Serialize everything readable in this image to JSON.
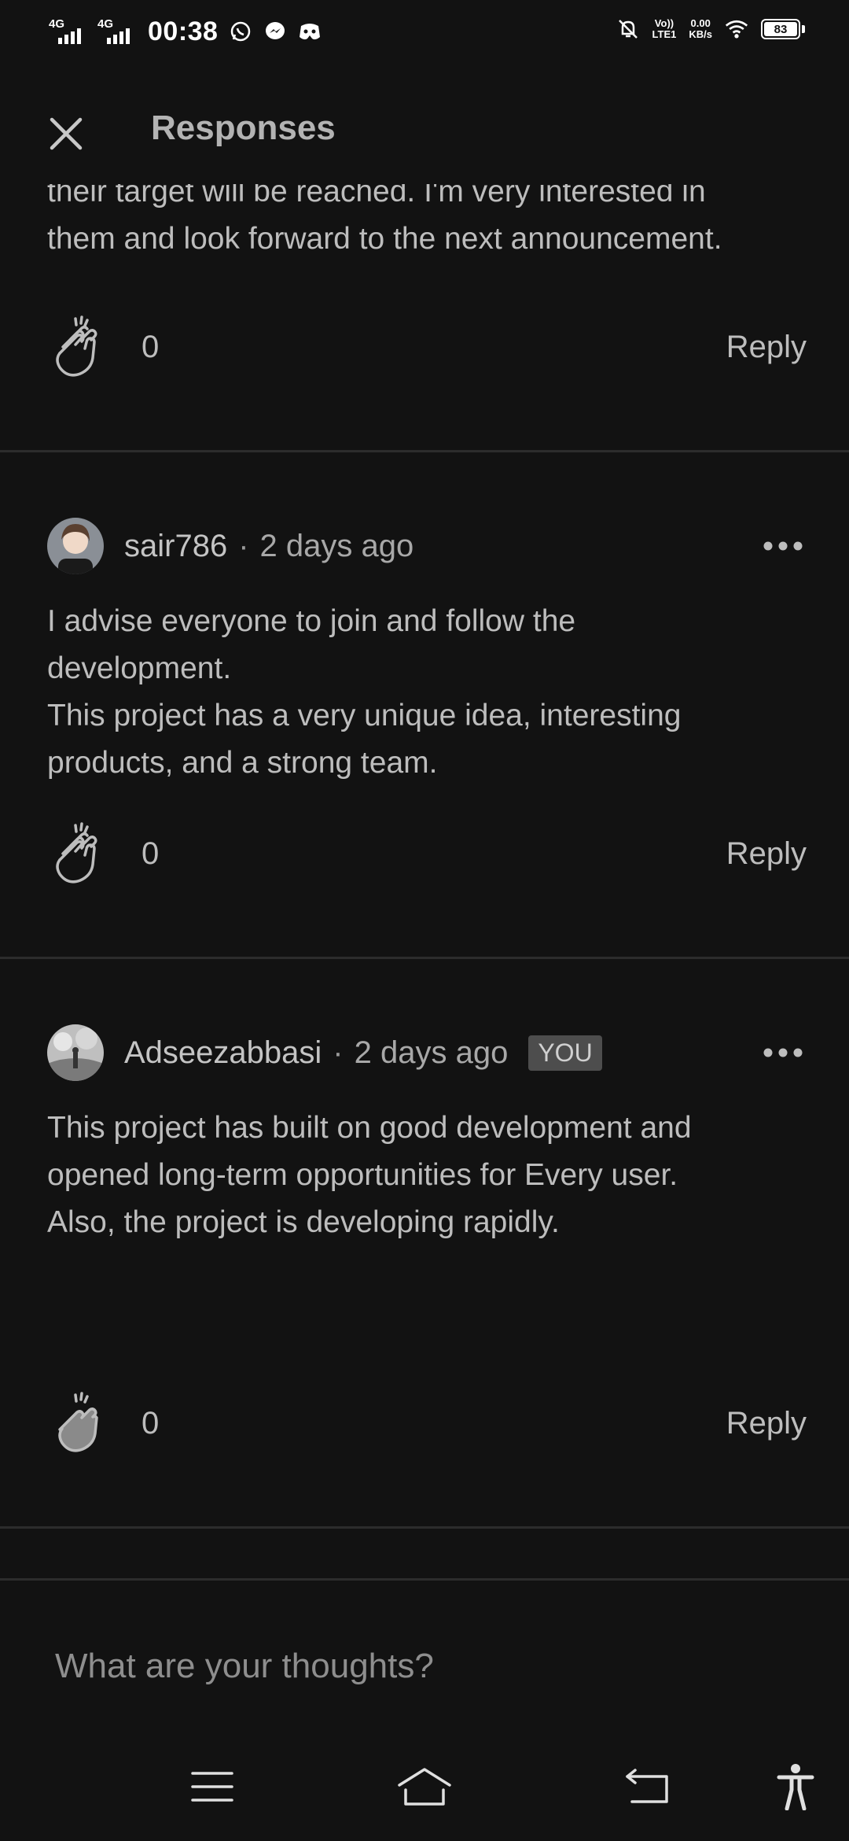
{
  "status_bar": {
    "network_1": "4G",
    "network_2": "4G",
    "time": "00:38",
    "volte_line1": "Vo))",
    "volte_line2": "LTE1",
    "speed_value": "0.00",
    "speed_unit": "KB/s",
    "battery": "83",
    "icons": [
      "whatsapp-icon",
      "messenger-icon",
      "discord-icon",
      "mute-notification-icon",
      "wifi-icon"
    ]
  },
  "header": {
    "title": "Responses",
    "close_icon": "close-icon"
  },
  "partial_response": {
    "text_line1": "their target will be reached. I'm very interested in",
    "text_line2": "them and look forward to the next announcement.",
    "clap_count": "0",
    "reply_label": "Reply"
  },
  "responses": [
    {
      "author": "sair786",
      "separator": "·",
      "time_ago": "2 days ago",
      "text_line1": "I advise everyone to join and follow the",
      "text_line2": "development.",
      "text_line3": "This project has a very unique idea, interesting",
      "text_line4": "products, and a strong team.",
      "clap_count": "0",
      "reply_label": "Reply"
    },
    {
      "author": "Adseezabbasi",
      "separator": "·",
      "time_ago": "2 days ago",
      "badge": "YOU",
      "text_line1": "This project has built on good development and",
      "text_line2": "opened long-term opportunities for Every user.",
      "text_line3": "Also, the project is developing rapidly.",
      "clap_count": "0",
      "reply_label": "Reply"
    }
  ],
  "compose": {
    "placeholder": "What are your thoughts?"
  },
  "nav_bar": {
    "icons": [
      "menu-icon",
      "home-icon",
      "back-icon",
      "accessibility-icon"
    ]
  },
  "colors": {
    "background": "#121212",
    "text": "#bdbdbd",
    "divider": "#2c2c2c",
    "badge": "#4d4d4d"
  }
}
